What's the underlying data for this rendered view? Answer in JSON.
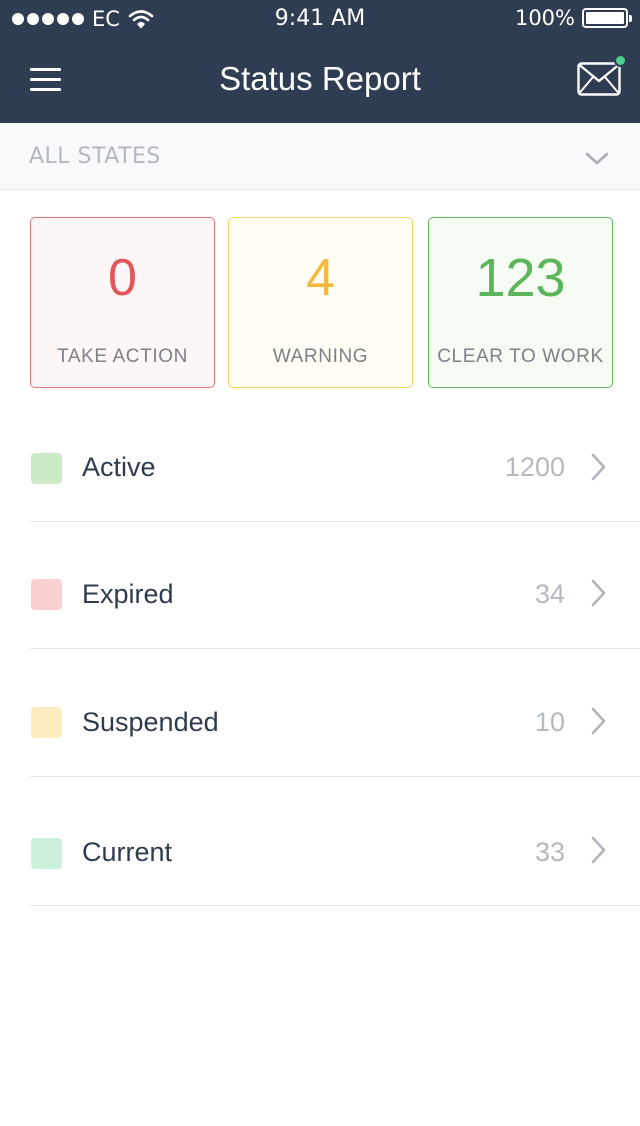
{
  "status_bar": {
    "carrier": "EC",
    "time": "9:41 AM",
    "battery": "100%"
  },
  "header": {
    "title": "Status Report",
    "menu_icon": "hamburger-menu-icon",
    "mail_icon": "envelope-icon",
    "notification_color": "#4ed08e"
  },
  "filter": {
    "label": "ALL STATES",
    "icon": "chevron-down-icon"
  },
  "summary_cards": [
    {
      "value": "0",
      "label": "TAKE ACTION",
      "color": "#e2555c"
    },
    {
      "value": "4",
      "label": "WARNING",
      "color": "#f2b93c"
    },
    {
      "value": "123",
      "label": "CLEAR TO WORK",
      "color": "#5bb55a"
    }
  ],
  "statuses": [
    {
      "label": "Active",
      "count": "1200",
      "color": "#cdeac8"
    },
    {
      "label": "Expired",
      "count": "34",
      "color": "#fbd0d0"
    },
    {
      "label": "Suspended",
      "count": "10",
      "color": "#fdecbf"
    },
    {
      "label": "Current",
      "count": "33",
      "color": "#cdf0dd"
    }
  ]
}
